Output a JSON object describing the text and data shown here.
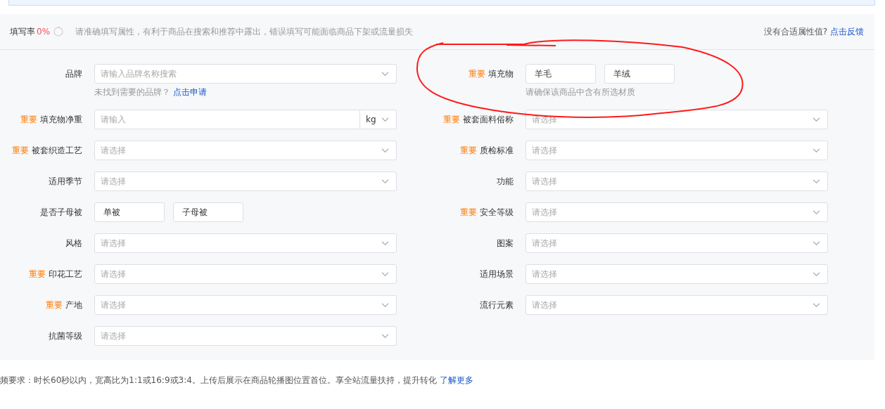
{
  "fill_rate": {
    "label": "填写率",
    "value": "0%",
    "level": 0,
    "notice": "请准确填写属性，有利于商品在搜索和推荐中露出，错误填写可能面临商品下架或流量损失"
  },
  "feedback": {
    "text": "没有合适属性值?",
    "link": "点击反馈"
  },
  "fields": [
    {
      "kind": "select",
      "label": "品牌",
      "placeholder": "请输入品牌名称搜索",
      "hint": "未找到需要的品牌？",
      "hint_link": "点击申请"
    },
    {
      "kind": "options",
      "tag": "重要",
      "label": "填充物",
      "options": [
        {
          "label": "羊毛",
          "selected": false
        },
        {
          "label": "羊绒",
          "selected": false
        }
      ],
      "hint": "请确保该商品中含有所选材质"
    },
    {
      "kind": "input_unit",
      "tag": "重要",
      "label": "填充物净重",
      "placeholder": "请输入",
      "unit": "kg"
    },
    {
      "kind": "select",
      "tag": "重要",
      "label": "被套面料俗称",
      "placeholder": "请选择"
    },
    {
      "kind": "select",
      "tag": "重要",
      "label": "被套织造工艺",
      "placeholder": "请选择"
    },
    {
      "kind": "select",
      "tag": "重要",
      "label": "质检标准",
      "placeholder": "请选择"
    },
    {
      "kind": "select",
      "label": "适用季节",
      "placeholder": "请选择"
    },
    {
      "kind": "select",
      "label": "功能",
      "placeholder": "请选择"
    },
    {
      "kind": "options",
      "label": "是否子母被",
      "options": [
        {
          "label": "单被",
          "selected": false
        },
        {
          "label": "子母被",
          "selected": false
        }
      ]
    },
    {
      "kind": "select",
      "tag": "重要",
      "label": "安全等级",
      "placeholder": "请选择"
    },
    {
      "kind": "select",
      "label": "风格",
      "placeholder": "请选择"
    },
    {
      "kind": "select",
      "label": "图案",
      "placeholder": "请选择"
    },
    {
      "kind": "select",
      "tag": "重要",
      "label": "印花工艺",
      "placeholder": "请选择"
    },
    {
      "kind": "select",
      "label": "适用场景",
      "placeholder": "请选择"
    },
    {
      "kind": "select",
      "tag": "重要",
      "label": "产地",
      "placeholder": "请选择"
    },
    {
      "kind": "select",
      "label": "流行元素",
      "placeholder": "请选择"
    },
    {
      "kind": "select",
      "label": "抗菌等级",
      "placeholder": "请选择"
    }
  ],
  "video_note": {
    "text": "频要求：时长60秒以内，宽高比为1:1或16:9或3:4。上传后展示在商品轮播图位置首位。享全站流量扶持，提升转化",
    "link": "了解更多"
  }
}
